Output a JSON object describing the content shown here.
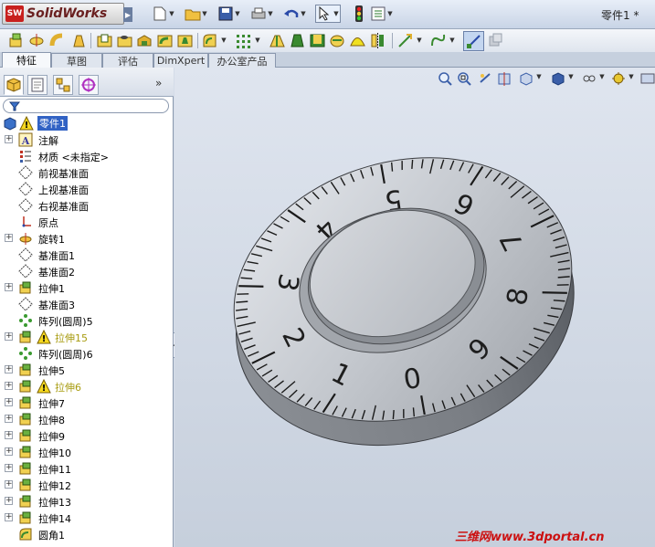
{
  "app": {
    "name": "SolidWorks",
    "badge": "SW",
    "document_title": "零件1 *"
  },
  "tabs": [
    "特征",
    "草图",
    "评估",
    "DimXpert",
    "办公室产品"
  ],
  "panel": {
    "more": "»"
  },
  "tree": {
    "root": "零件1",
    "items": [
      {
        "label": "注解",
        "icon": "annotation-icon",
        "expand": true,
        "warn": false
      },
      {
        "label": "材质 <未指定>",
        "icon": "material-icon",
        "expand": false,
        "warn": false
      },
      {
        "label": "前视基准面",
        "icon": "plane-icon",
        "expand": false,
        "warn": false
      },
      {
        "label": "上视基准面",
        "icon": "plane-icon",
        "expand": false,
        "warn": false
      },
      {
        "label": "右视基准面",
        "icon": "plane-icon",
        "expand": false,
        "warn": false
      },
      {
        "label": "原点",
        "icon": "origin-icon",
        "expand": false,
        "warn": false
      },
      {
        "label": "旋转1",
        "icon": "revolve-icon",
        "expand": true,
        "warn": false
      },
      {
        "label": "基准面1",
        "icon": "plane-icon",
        "expand": false,
        "warn": false
      },
      {
        "label": "基准面2",
        "icon": "plane-icon",
        "expand": false,
        "warn": false
      },
      {
        "label": "拉伸1",
        "icon": "extrude-icon",
        "expand": true,
        "warn": false
      },
      {
        "label": "基准面3",
        "icon": "plane-icon",
        "expand": false,
        "warn": false
      },
      {
        "label": "阵列(圆周)5",
        "icon": "pattern-icon",
        "expand": false,
        "warn": false
      },
      {
        "label": "拉伸15",
        "icon": "extrude-icon",
        "expand": true,
        "warn": true
      },
      {
        "label": "阵列(圆周)6",
        "icon": "pattern-icon",
        "expand": false,
        "warn": false
      },
      {
        "label": "拉伸5",
        "icon": "extrude-icon",
        "expand": true,
        "warn": false
      },
      {
        "label": "拉伸6",
        "icon": "extrude-icon",
        "expand": true,
        "warn": true
      },
      {
        "label": "拉伸7",
        "icon": "extrude-icon",
        "expand": true,
        "warn": false
      },
      {
        "label": "拉伸8",
        "icon": "extrude-icon",
        "expand": true,
        "warn": false
      },
      {
        "label": "拉伸9",
        "icon": "extrude-icon",
        "expand": true,
        "warn": false
      },
      {
        "label": "拉伸10",
        "icon": "extrude-icon",
        "expand": true,
        "warn": false
      },
      {
        "label": "拉伸11",
        "icon": "extrude-icon",
        "expand": true,
        "warn": false
      },
      {
        "label": "拉伸12",
        "icon": "extrude-icon",
        "expand": true,
        "warn": false
      },
      {
        "label": "拉伸13",
        "icon": "extrude-icon",
        "expand": true,
        "warn": false
      },
      {
        "label": "拉伸14",
        "icon": "extrude-icon",
        "expand": true,
        "warn": false
      },
      {
        "label": "圆角1",
        "icon": "fillet-icon",
        "expand": false,
        "warn": false
      }
    ]
  },
  "dial": {
    "numbers": [
      "0",
      "1",
      "2",
      "3",
      "4",
      "5",
      "6",
      "7",
      "8",
      "9"
    ]
  },
  "watermark": "三维网www.3dportal.cn",
  "colors": {
    "highlight": "#3162c4",
    "warn_text": "#a89c10",
    "brand": "#c8201e",
    "watermark": "#cc1010"
  }
}
